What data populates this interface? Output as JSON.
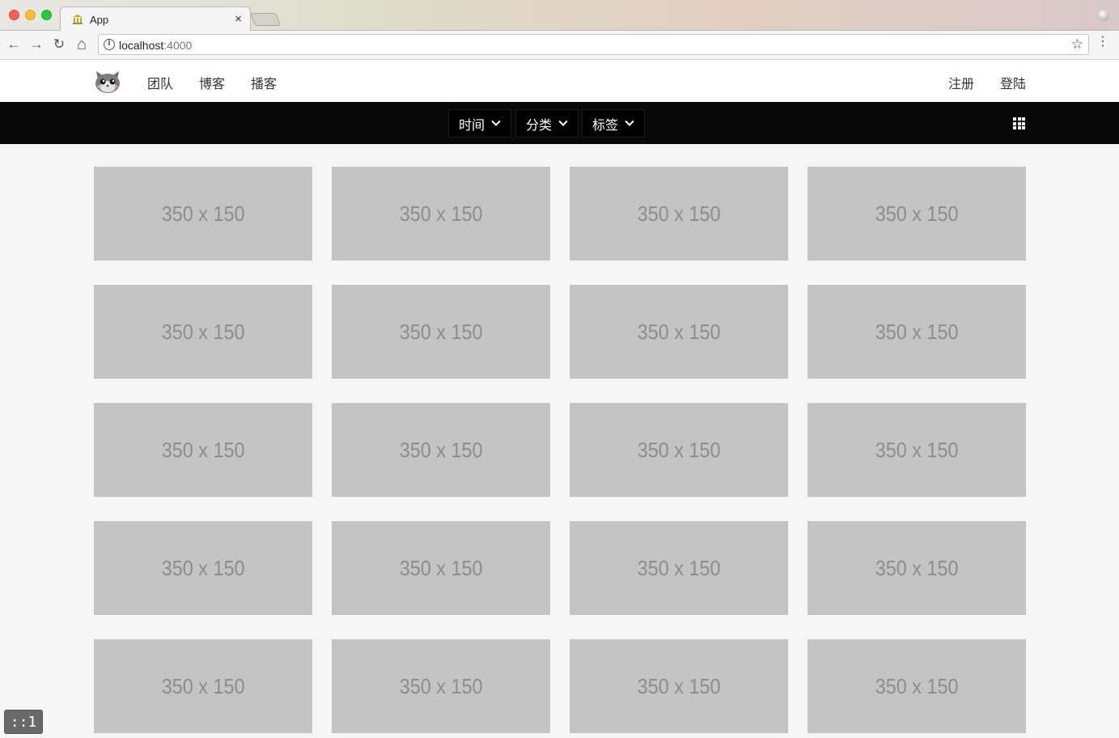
{
  "browser": {
    "tab_title": "App",
    "tab_close": "×",
    "url_host": "localhost",
    "url_port": ":4000",
    "info_icon": "i",
    "star": "☆",
    "menu": "⋮",
    "back": "←",
    "forward": "→",
    "reload": "↻",
    "home": "⌂"
  },
  "header": {
    "nav": [
      "团队",
      "博客",
      "播客"
    ],
    "register": "注册",
    "login": "登陆"
  },
  "filters": {
    "time": "时间",
    "category": "分类",
    "tags": "标签"
  },
  "cards": [
    "350 x 150",
    "350 x 150",
    "350 x 150",
    "350 x 150",
    "350 x 150",
    "350 x 150",
    "350 x 150",
    "350 x 150",
    "350 x 150",
    "350 x 150",
    "350 x 150",
    "350 x 150",
    "350 x 150",
    "350 x 150",
    "350 x 150",
    "350 x 150",
    "350 x 150",
    "350 x 150",
    "350 x 150",
    "350 x 150"
  ],
  "dev_indicator": "::1",
  "colors": {
    "filter_bar": "#080808",
    "card": "#c4c4c4",
    "card_text": "#8d8d8d",
    "page_bg": "#f6f6f6"
  }
}
